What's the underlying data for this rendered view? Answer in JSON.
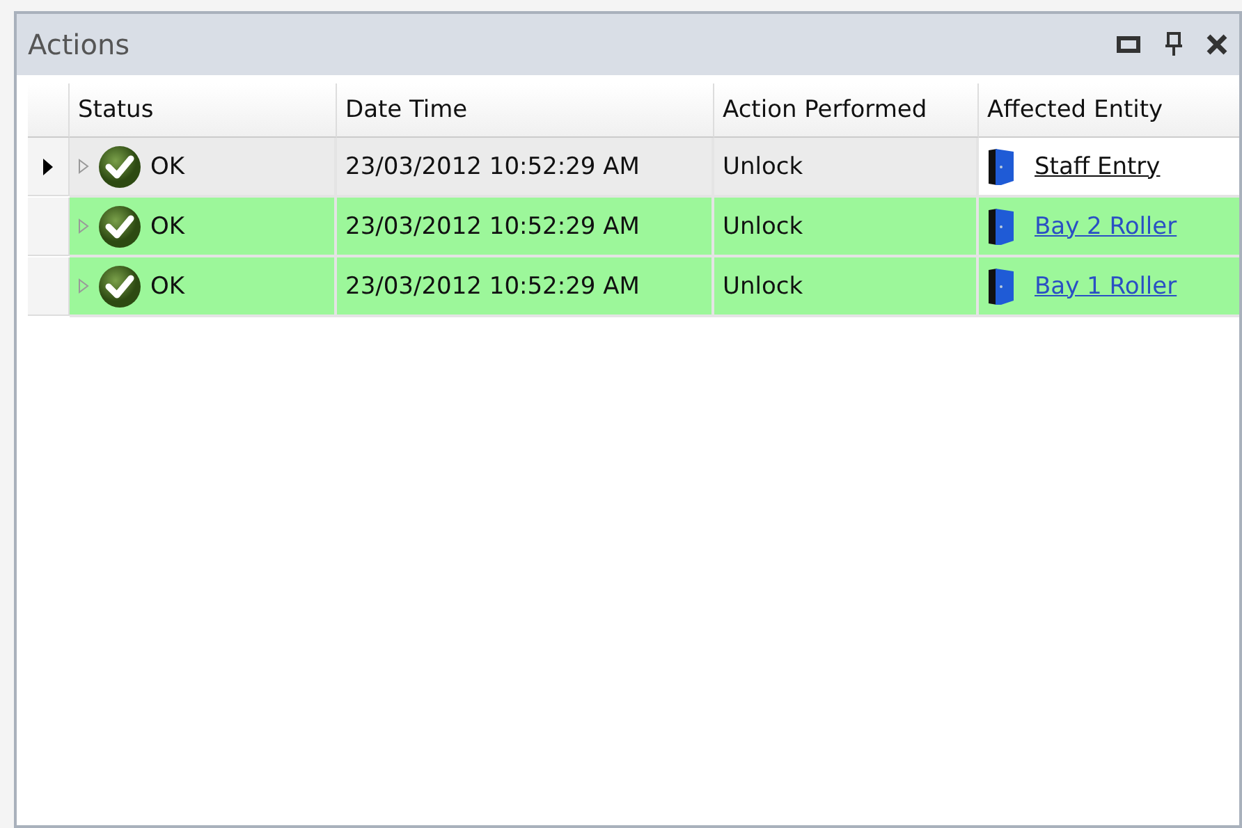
{
  "panel": {
    "title": "Actions"
  },
  "table": {
    "columns": [
      "Status",
      "Date Time",
      "Action Performed",
      "Affected Entity"
    ],
    "rows": [
      {
        "selected": true,
        "status": "OK",
        "datetime": "23/03/2012 10:52:29 AM",
        "action": "Unlock",
        "entity": "Staff Entry"
      },
      {
        "selected": false,
        "status": "OK",
        "datetime": "23/03/2012 10:52:29 AM",
        "action": "Unlock",
        "entity": "Bay 2 Roller"
      },
      {
        "selected": false,
        "status": "OK",
        "datetime": "23/03/2012 10:52:29 AM",
        "action": "Unlock",
        "entity": "Bay 1 Roller"
      }
    ]
  }
}
